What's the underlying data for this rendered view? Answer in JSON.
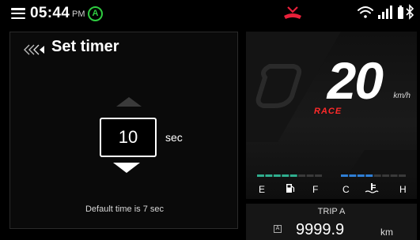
{
  "status_bar": {
    "time": "05:44",
    "ampm": "PM",
    "mode_badge": "A",
    "icons": [
      "menu-icon",
      "missed-call-icon",
      "wifi-icon",
      "signal-icon",
      "battery-icon",
      "bluetooth-icon"
    ]
  },
  "timer": {
    "title": "Set timer",
    "value": "10",
    "unit": "sec",
    "hint": "Default time is 7 sec"
  },
  "speed": {
    "value": "20",
    "unit": "km/h",
    "mode": "RACE"
  },
  "gauges": {
    "fuel_empty": "E",
    "fuel_full": "F",
    "temp_cold": "C",
    "temp_hot": "H",
    "fuel_level": 0.6,
    "temp_level": 0.55
  },
  "trip": {
    "label": "TRIP A",
    "badge": "A",
    "value": "9999.9",
    "unit": "km"
  },
  "colors": {
    "accent_green": "#2ecc40",
    "race_red": "#ff2a2a",
    "fuel_bar": "#2fae8e",
    "temp_bar": "#2f7fd6",
    "missed_call": "#e8203a"
  }
}
